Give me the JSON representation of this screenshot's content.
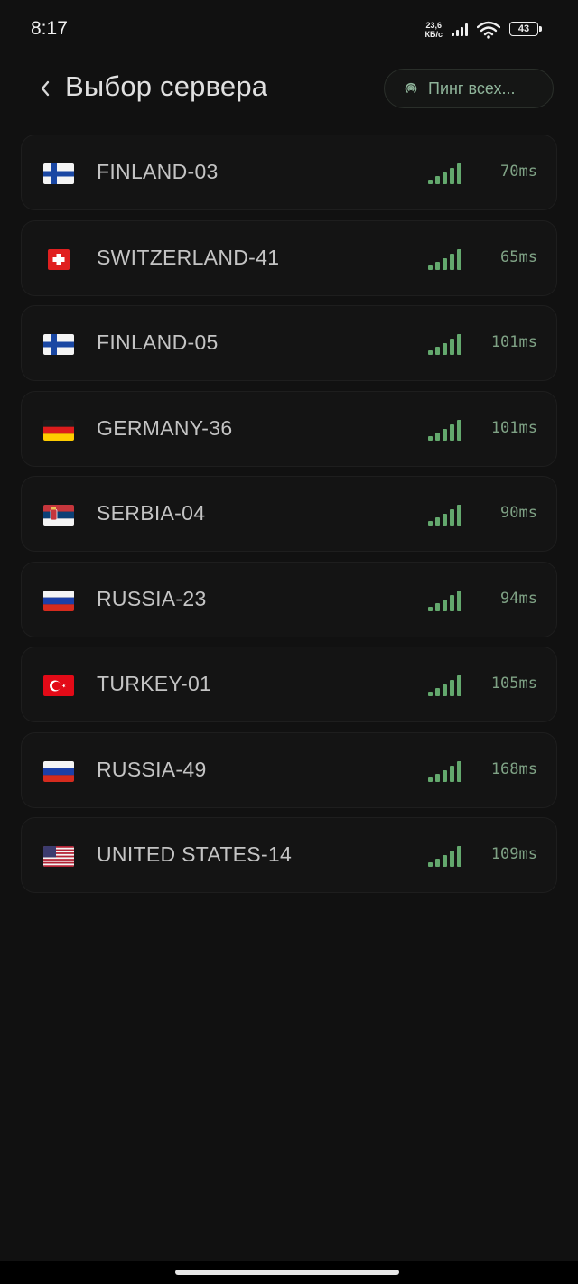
{
  "status": {
    "time": "8:17",
    "net_speed_value": "23,6",
    "net_speed_unit": "КБ/с",
    "battery": "43"
  },
  "header": {
    "title": "Выбор сервера",
    "ping_all_label": "Пинг всех..."
  },
  "servers": [
    {
      "name": "FINLAND-03",
      "flag": "finland-flag",
      "ping": "70ms"
    },
    {
      "name": "SWITZERLAND-41",
      "flag": "switzerland-flag",
      "ping": "65ms"
    },
    {
      "name": "FINLAND-05",
      "flag": "finland-flag",
      "ping": "101ms"
    },
    {
      "name": "GERMANY-36",
      "flag": "germany-flag",
      "ping": "101ms"
    },
    {
      "name": "SERBIA-04",
      "flag": "serbia-flag",
      "ping": "90ms"
    },
    {
      "name": "RUSSIA-23",
      "flag": "russia-flag",
      "ping": "94ms"
    },
    {
      "name": "TURKEY-01",
      "flag": "turkey-flag",
      "ping": "105ms"
    },
    {
      "name": "RUSSIA-49",
      "flag": "russia-flag",
      "ping": "168ms"
    },
    {
      "name": "UNITED STATES-14",
      "flag": "united-states-flag",
      "ping": "109ms"
    }
  ],
  "colors": {
    "background": "#111111",
    "accent_green": "#63a86d",
    "ping_text": "#7fa285"
  }
}
